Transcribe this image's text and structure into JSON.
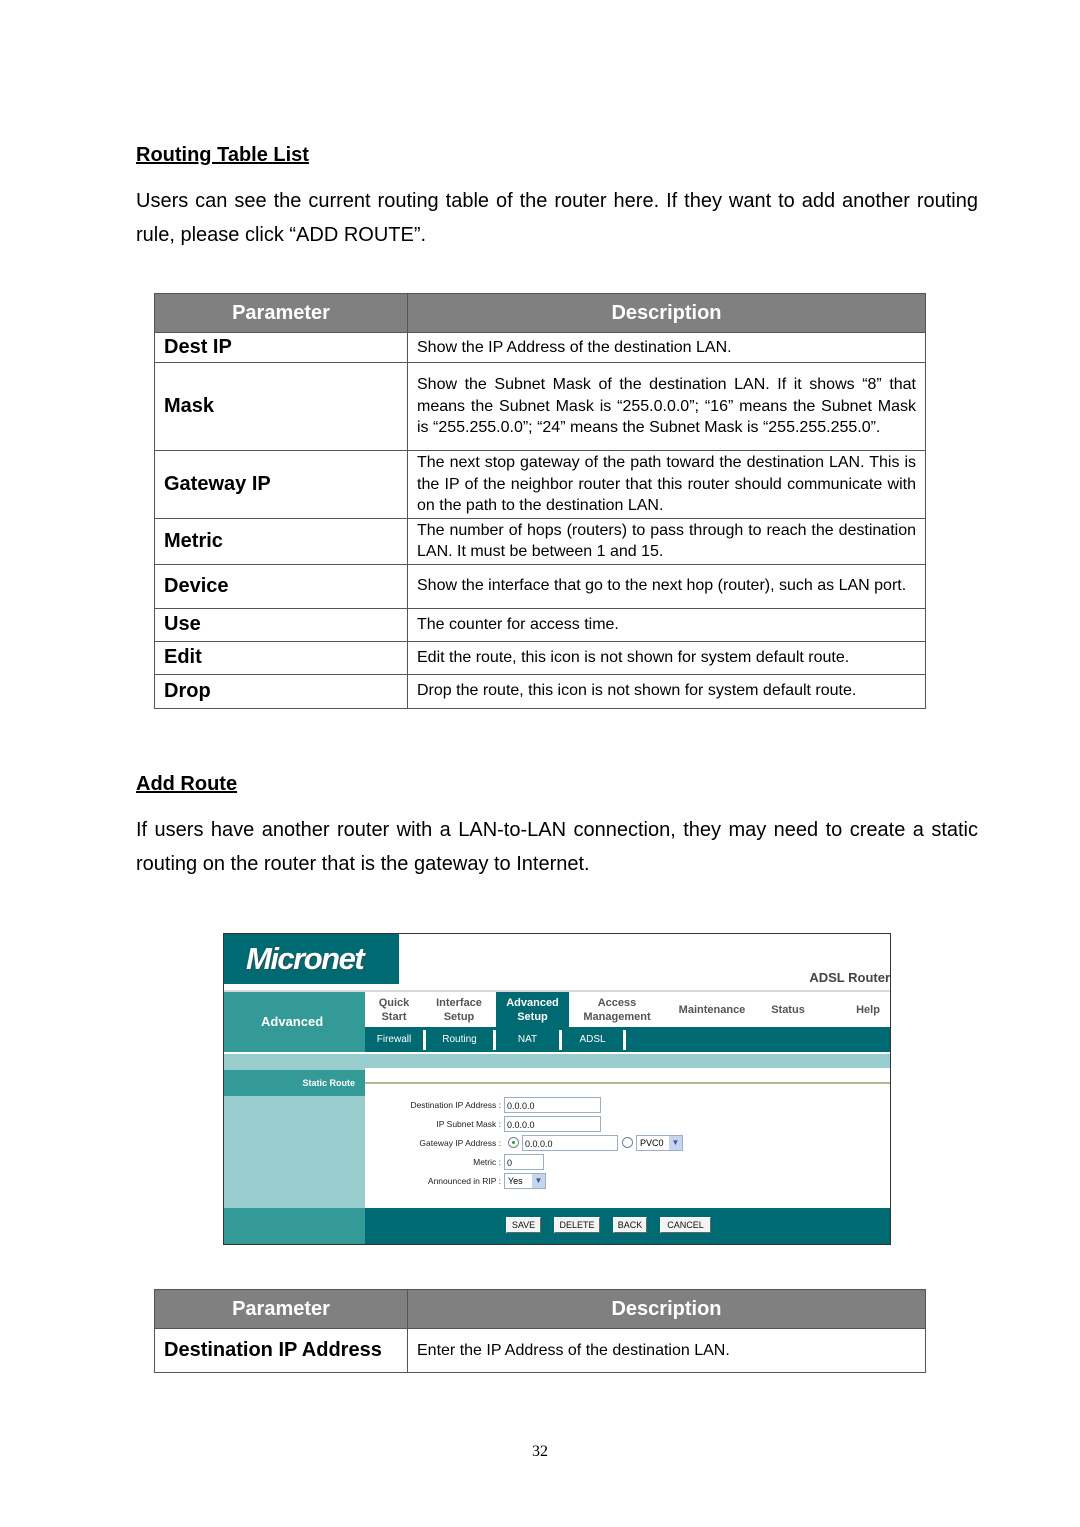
{
  "section1": {
    "title": "Routing Table List",
    "paragraph": "Users can see the current routing table of the router here. If they want to add another routing rule, please click “ADD ROUTE”."
  },
  "table1": {
    "headers": [
      "Parameter",
      "Description"
    ],
    "rows": [
      {
        "param": "Dest IP",
        "desc": "Show the IP Address of the destination LAN."
      },
      {
        "param": "Mask",
        "desc": "Show the Subnet Mask of the destination LAN. If it shows “8” that means the Subnet Mask is “255.0.0.0”; “16” means the Subnet Mask is “255.255.0.0”; “24” means the Subnet Mask is “255.255.255.0”."
      },
      {
        "param": "Gateway IP",
        "desc": "The next stop gateway of the path toward the destination LAN. This is the IP of the neighbor router that this router should communicate with on the path to the destination LAN."
      },
      {
        "param": "Metric",
        "desc": "The number of hops (routers) to pass through to reach the destination LAN. It must be between 1 and 15."
      },
      {
        "param": "Device",
        "desc": "Show the interface that go to the next hop (router), such as LAN port."
      },
      {
        "param": "Use",
        "desc": "The counter for access time."
      },
      {
        "param": "Edit",
        "desc": "Edit the route, this icon is not shown for system default route."
      },
      {
        "param": "Drop",
        "desc": "Drop the route, this icon is not shown for system default route."
      }
    ]
  },
  "section2": {
    "title": "Add Route",
    "paragraph": "If users have another router with a LAN-to-LAN connection, they may need to create a static routing on the router that is the gateway to Internet."
  },
  "router_ui": {
    "logo": "Micronet",
    "product": "ADSL Router",
    "side_title": "Advanced",
    "tabs": [
      {
        "label_line1": "Quick",
        "label_line2": "Start",
        "active": false
      },
      {
        "label_line1": "Interface",
        "label_line2": "Setup",
        "active": false
      },
      {
        "label_line1": "Advanced",
        "label_line2": "Setup",
        "active": true
      },
      {
        "label_line1": "Access",
        "label_line2": "Management",
        "active": false
      },
      {
        "label_line1": "Maintenance",
        "label_line2": "",
        "active": false
      },
      {
        "label_line1": "Status",
        "label_line2": "",
        "active": false
      },
      {
        "label_line1": "Help",
        "label_line2": "",
        "active": false
      }
    ],
    "subtabs": [
      "Firewall",
      "Routing",
      "NAT",
      "ADSL"
    ],
    "section_label": "Static Route",
    "form": {
      "dest_ip_label": "Destination IP Address :",
      "dest_ip_value": "0.0.0.0",
      "mask_label": "IP Subnet Mask :",
      "mask_value": "0.0.0.0",
      "gateway_label": "Gateway IP Address :",
      "gateway_value": "0.0.0.0",
      "gateway_ip_selected": true,
      "interface_value": "PVC0",
      "metric_label": "Metric :",
      "metric_value": "0",
      "rip_label": "Announced in RIP :",
      "rip_value": "Yes"
    },
    "buttons": [
      "SAVE",
      "DELETE",
      "BACK",
      "CANCEL"
    ],
    "colors": {
      "dark_teal": "#006a72",
      "mid_teal": "#339a97",
      "light_teal": "#99cccc"
    }
  },
  "table2": {
    "headers": [
      "Parameter",
      "Description"
    ],
    "rows": [
      {
        "param": "Destination IP Address",
        "desc": "Enter the IP Address of the destination LAN."
      }
    ]
  },
  "page_number": "32"
}
